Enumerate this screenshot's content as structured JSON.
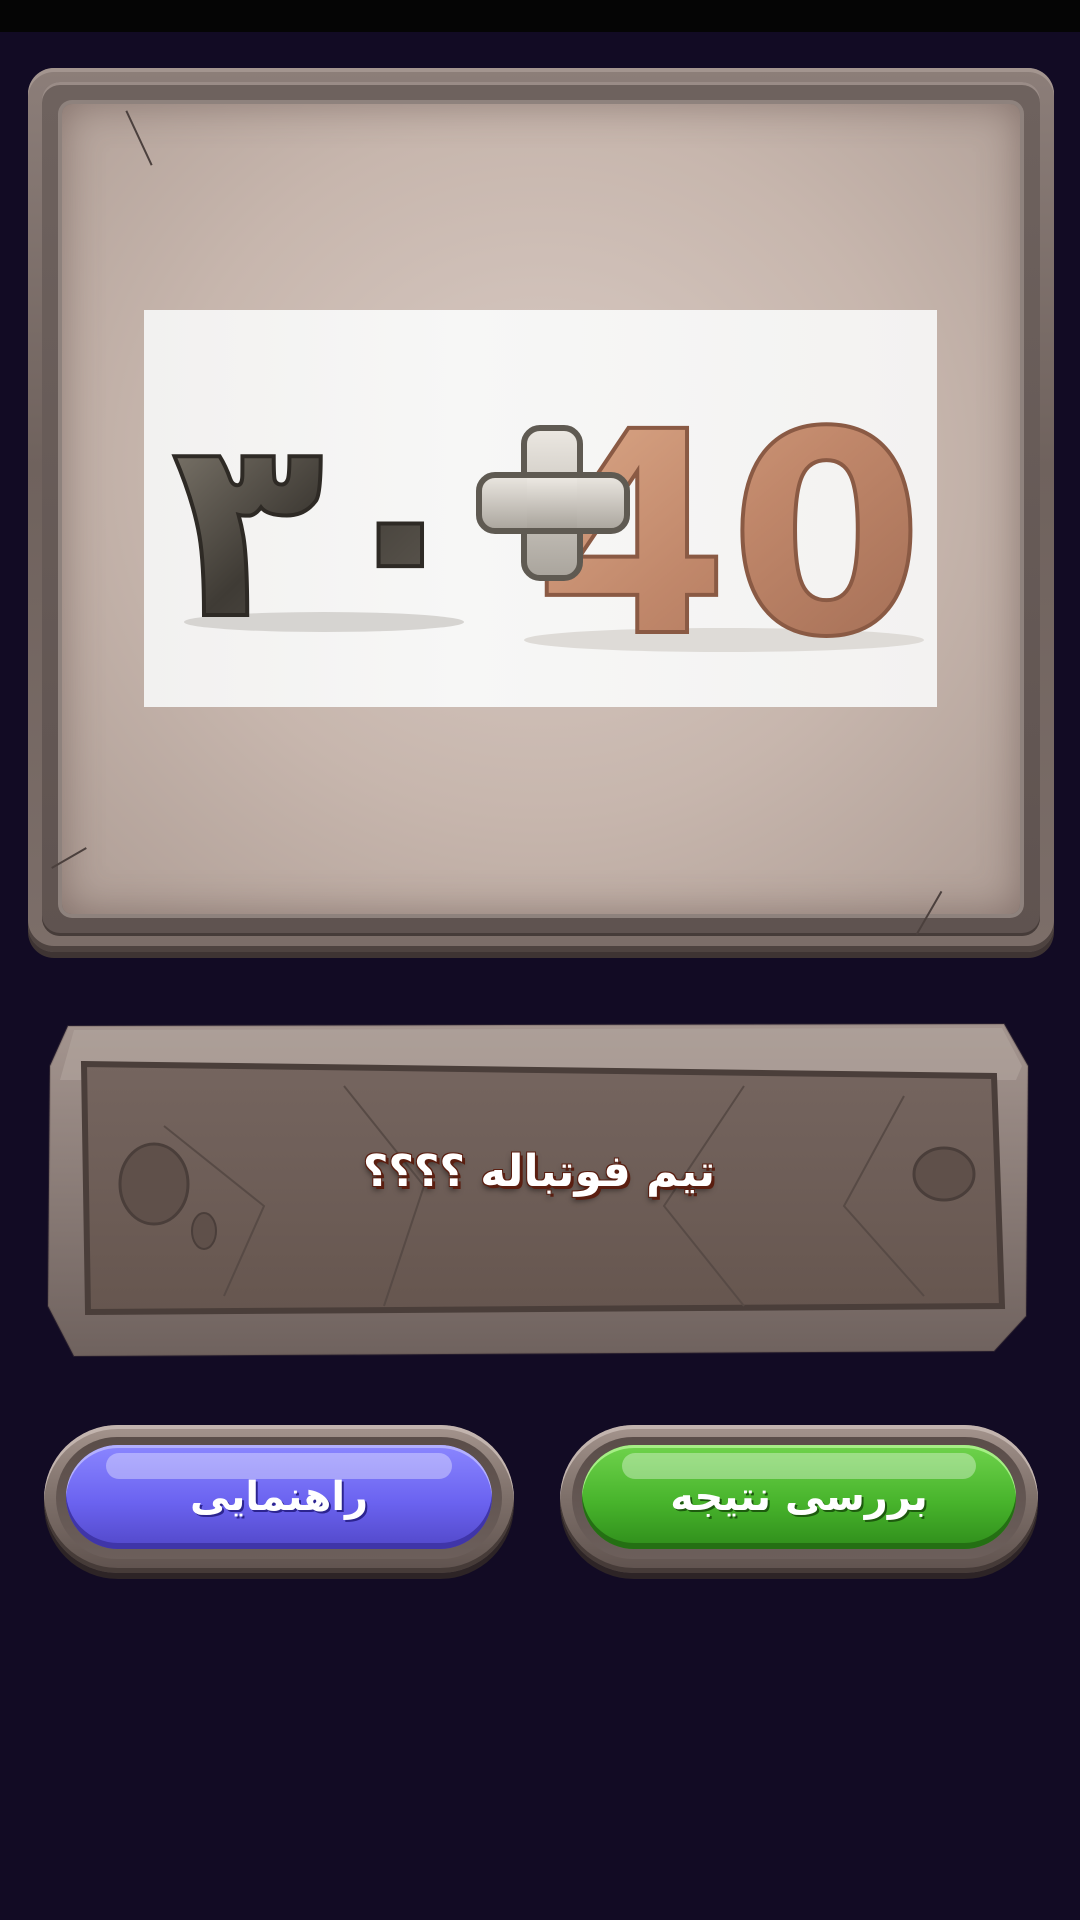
{
  "question": {
    "text": "تیم فوتباله ؟؟؟؟"
  },
  "puzzle_image": {
    "left_number": "۳۰",
    "operator": "+",
    "right_number": "40"
  },
  "buttons": {
    "hint_label": "راهنمایی",
    "check_label": "بررسی نتیجه"
  },
  "colors": {
    "background": "#120b24",
    "hint_button": "#6b63f0",
    "check_button": "#48b42c",
    "stone": "#7c6e69"
  }
}
